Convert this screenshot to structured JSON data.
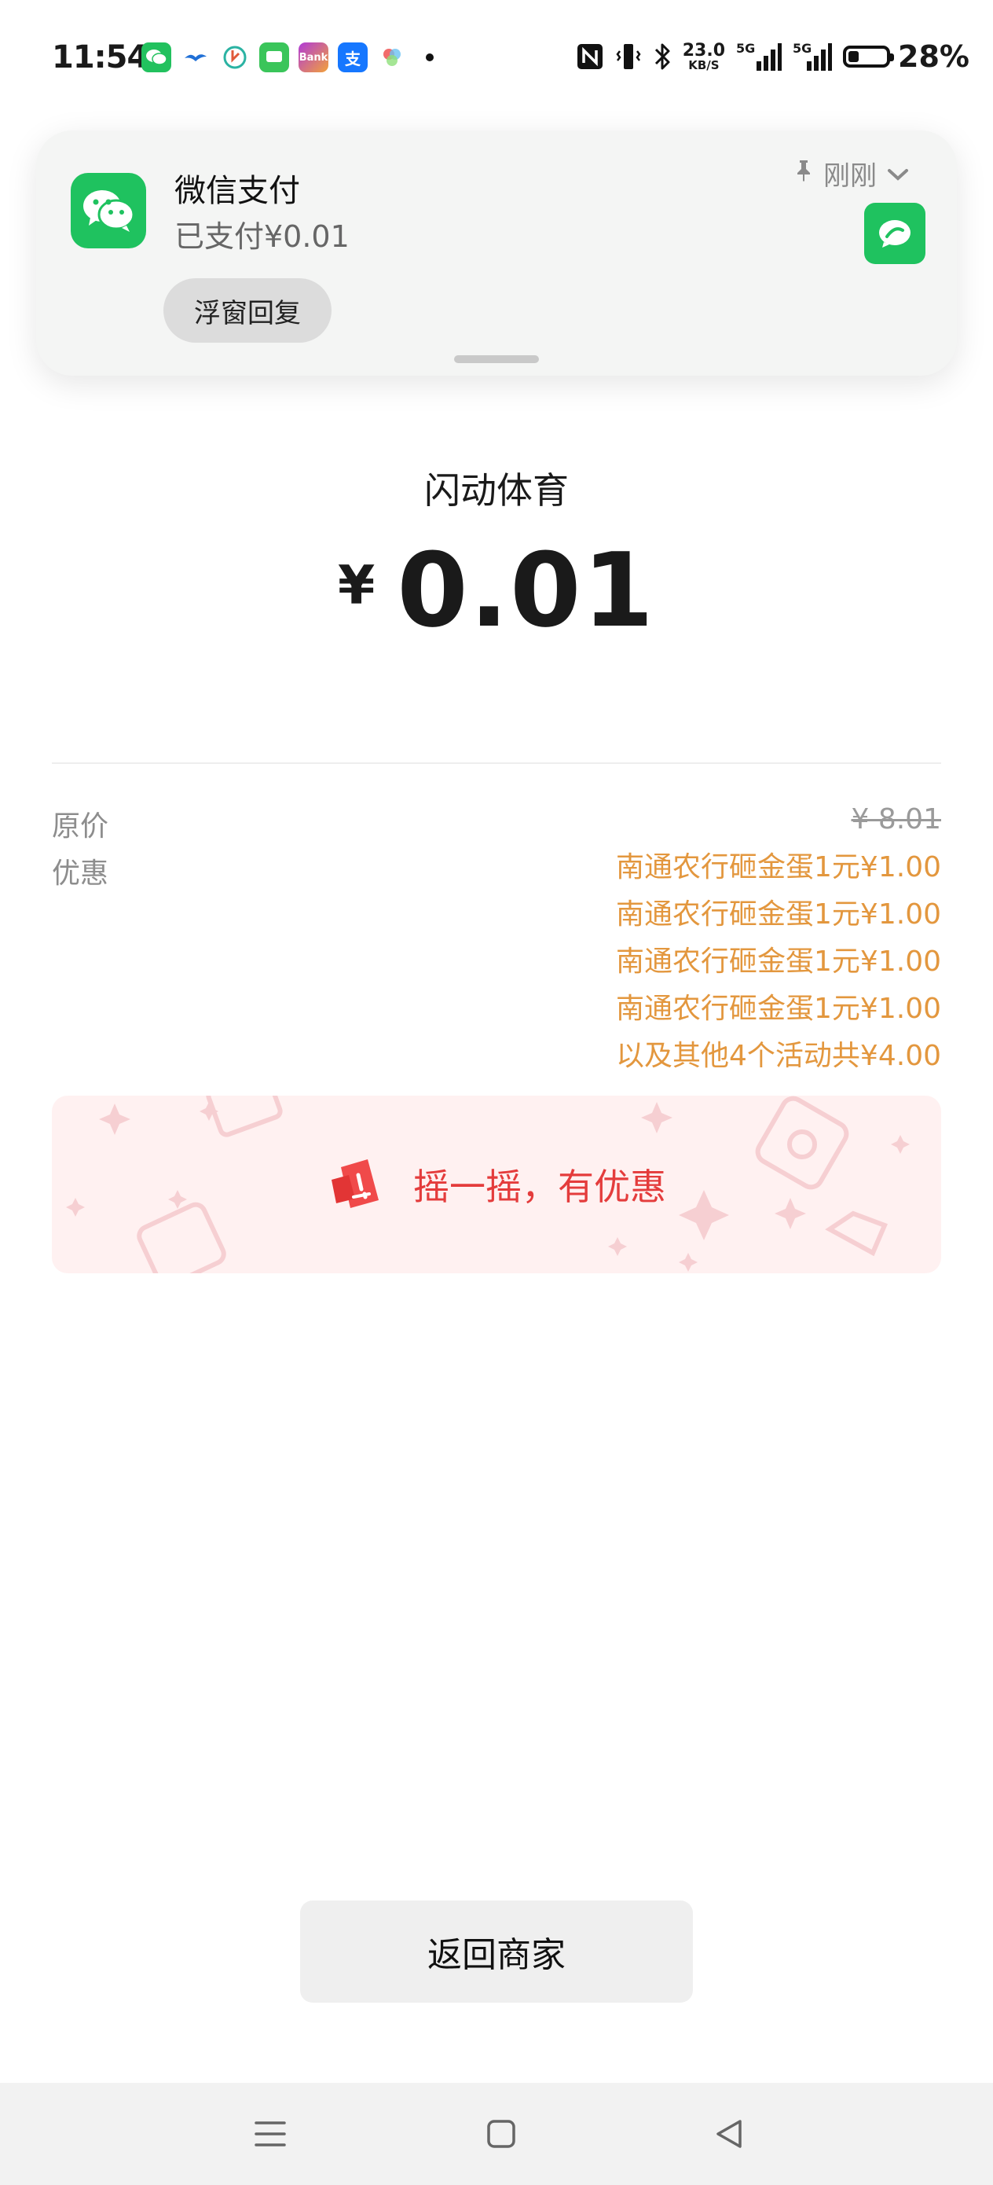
{
  "status_bar": {
    "time": "11:54",
    "net_speed_value": "23.0",
    "net_speed_unit": "KB/S",
    "signal1_label": "5G",
    "signal2_label": "5G",
    "battery_percent": "28%",
    "battery_level": 0.28,
    "app_icons": [
      "wechat-icon",
      "bird-app-icon",
      "power-app-icon",
      "messages-icon",
      "bank-app-icon",
      "alipay-icon",
      "photos-app-icon"
    ],
    "alipay_char": "支",
    "bank_text": "Bank"
  },
  "notification": {
    "app_name": "微信支付",
    "body": "已支付¥0.01",
    "reply_button": "浮窗回复",
    "time": "刚刚"
  },
  "payment": {
    "merchant": "闪动体育",
    "currency": "¥",
    "amount": "0.01"
  },
  "details": {
    "original_label": "原价",
    "original_price": "¥ 8.01",
    "discount_label": "优惠",
    "discounts": [
      "南通农行砸金蛋1元¥1.00",
      "南通农行砸金蛋1元¥1.00",
      "南通农行砸金蛋1元¥1.00",
      "南通农行砸金蛋1元¥1.00",
      "以及其他4个活动共¥4.00"
    ]
  },
  "shake_banner": {
    "text": "摇一摇，有优惠"
  },
  "return_button": "返回商家",
  "colors": {
    "wechat_green": "#1fc25f",
    "discount_orange": "#e3973e",
    "shake_red": "#e43c3c",
    "shake_bg": "#fff1f1"
  }
}
